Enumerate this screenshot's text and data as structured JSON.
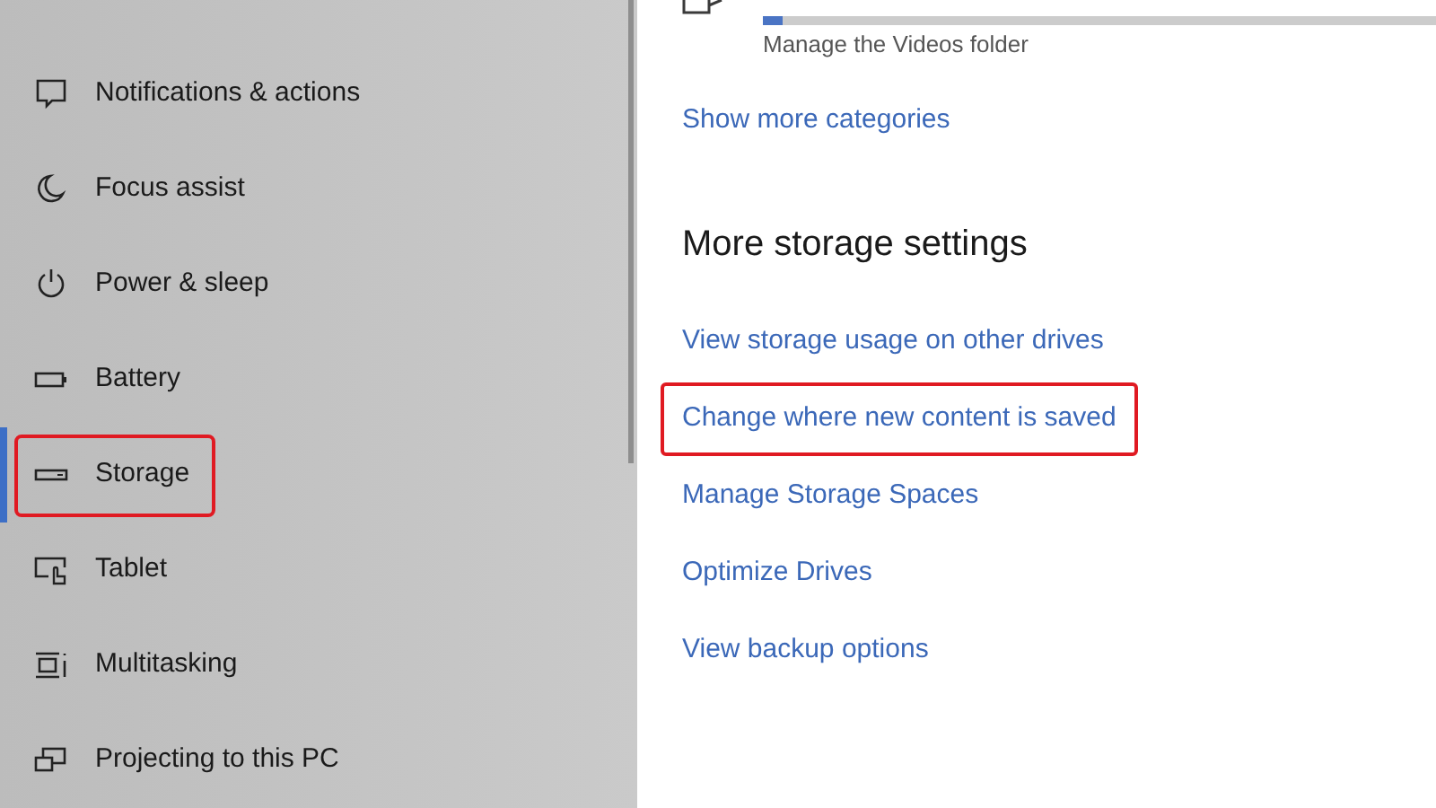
{
  "sidebar": {
    "items": [
      {
        "kind": "notifications",
        "label": "Notifications & actions",
        "selected": false,
        "highlighted": false
      },
      {
        "kind": "focus",
        "label": "Focus assist",
        "selected": false,
        "highlighted": false
      },
      {
        "kind": "power",
        "label": "Power & sleep",
        "selected": false,
        "highlighted": false
      },
      {
        "kind": "battery",
        "label": "Battery",
        "selected": false,
        "highlighted": false
      },
      {
        "kind": "storage",
        "label": "Storage",
        "selected": true,
        "highlighted": true
      },
      {
        "kind": "tablet",
        "label": "Tablet",
        "selected": false,
        "highlighted": false
      },
      {
        "kind": "multitasking",
        "label": "Multitasking",
        "selected": false,
        "highlighted": false
      },
      {
        "kind": "projecting",
        "label": "Projecting to this PC",
        "selected": false,
        "highlighted": false
      }
    ]
  },
  "videos": {
    "level": 0.03,
    "caption": "Manage the Videos folder"
  },
  "show_more": "Show more categories",
  "more_storage": {
    "heading": "More storage settings",
    "links": [
      {
        "label": "View storage usage on other drives",
        "highlighted": false
      },
      {
        "label": "Change where new content is saved",
        "highlighted": true
      },
      {
        "label": "Manage Storage Spaces",
        "highlighted": false
      },
      {
        "label": "Optimize Drives",
        "highlighted": false
      },
      {
        "label": "View backup options",
        "highlighted": false
      }
    ]
  }
}
